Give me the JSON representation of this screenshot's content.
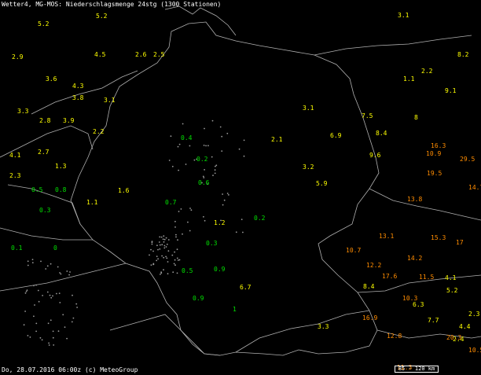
{
  "header": {
    "title": "Wetter4, MG-MOS: Niederschlagsmenge 24stg (1300 Stationen)"
  },
  "footer": {
    "date": "Do, 28.07.2016 06:00z (c) MeteoGroup"
  },
  "scale": {
    "label": "85 - 120 km"
  },
  "colors": {
    "background": "#000000",
    "border": "#b0b0b0",
    "dry_dot": "#9a9a9a",
    "class_low": "#00e000",
    "class_mid": "#ffff00",
    "class_high": "#ff8c00"
  },
  "stations": [
    {
      "v": "5.2",
      "c": "mid"
    },
    {
      "v": "5.2",
      "c": "mid"
    },
    {
      "v": "2.9",
      "c": "mid"
    },
    {
      "v": "4.5",
      "c": "mid"
    },
    {
      "v": "2.6",
      "c": "mid"
    },
    {
      "v": "2.5",
      "c": "mid"
    },
    {
      "v": "3.6",
      "c": "mid"
    },
    {
      "v": "4.3",
      "c": "mid"
    },
    {
      "v": "3.8",
      "c": "mid"
    },
    {
      "v": "3.1",
      "c": "mid"
    },
    {
      "v": "3.3",
      "c": "mid"
    },
    {
      "v": "2.8",
      "c": "mid"
    },
    {
      "v": "3.9",
      "c": "mid"
    },
    {
      "v": "2.2",
      "c": "mid"
    },
    {
      "v": "2.7",
      "c": "mid"
    },
    {
      "v": "1.3",
      "c": "mid"
    },
    {
      "v": "4.1",
      "c": "mid"
    },
    {
      "v": "1.1",
      "c": "mid"
    },
    {
      "v": "2.3",
      "c": "mid"
    },
    {
      "v": "1.6",
      "c": "mid"
    },
    {
      "v": "0.5",
      "c": "low"
    },
    {
      "v": "0.3",
      "c": "low"
    },
    {
      "v": "0.8",
      "c": "low"
    },
    {
      "v": "0.1",
      "c": "low"
    },
    {
      "v": "0",
      "c": "low"
    },
    {
      "v": "0.4",
      "c": "low"
    },
    {
      "v": "0.2",
      "c": "low"
    },
    {
      "v": "0.6",
      "c": "low"
    },
    {
      "v": "0.7",
      "c": "low"
    },
    {
      "v": "0.9",
      "c": "low"
    },
    {
      "v": "3.1",
      "c": "mid"
    },
    {
      "v": "2.1",
      "c": "mid"
    },
    {
      "v": "1.2",
      "c": "mid"
    },
    {
      "v": "3.2",
      "c": "mid"
    },
    {
      "v": "6.7",
      "c": "mid"
    },
    {
      "v": "9.6",
      "c": "mid"
    },
    {
      "v": "8.4",
      "c": "mid"
    },
    {
      "v": "7.5",
      "c": "mid"
    },
    {
      "v": "6.9",
      "c": "mid"
    },
    {
      "v": "5.9",
      "c": "mid"
    },
    {
      "v": "16.3",
      "c": "high"
    },
    {
      "v": "10.9",
      "c": "high"
    },
    {
      "v": "19.5",
      "c": "high"
    },
    {
      "v": "29.5",
      "c": "high"
    },
    {
      "v": "14.7",
      "c": "high"
    },
    {
      "v": "13.8",
      "c": "high"
    },
    {
      "v": "15.3",
      "c": "high"
    },
    {
      "v": "17",
      "c": "high"
    },
    {
      "v": "14.2",
      "c": "high"
    },
    {
      "v": "10.7",
      "c": "high"
    },
    {
      "v": "12.2",
      "c": "high"
    },
    {
      "v": "17.6",
      "c": "high"
    },
    {
      "v": "11.5",
      "c": "high"
    },
    {
      "v": "13.1",
      "c": "high"
    },
    {
      "v": "10.3",
      "c": "high"
    },
    {
      "v": "16.9",
      "c": "high"
    },
    {
      "v": "12.8",
      "c": "high"
    },
    {
      "v": "11.3",
      "c": "high"
    },
    {
      "v": "20.3",
      "c": "high"
    },
    {
      "v": "10.5",
      "c": "high"
    },
    {
      "v": "3.1",
      "c": "mid"
    },
    {
      "v": "8.2",
      "c": "mid"
    },
    {
      "v": "2.2",
      "c": "mid"
    },
    {
      "v": "1.1",
      "c": "mid"
    },
    {
      "v": "9.1",
      "c": "mid"
    },
    {
      "v": "8",
      "c": "mid"
    },
    {
      "v": "4.1",
      "c": "mid"
    },
    {
      "v": "5.2",
      "c": "mid"
    },
    {
      "v": "2.3",
      "c": "mid"
    },
    {
      "v": "4.4",
      "c": "mid"
    },
    {
      "v": "7.7",
      "c": "mid"
    },
    {
      "v": "3.3",
      "c": "mid"
    },
    {
      "v": "8.4",
      "c": "mid"
    },
    {
      "v": "6.3",
      "c": "mid"
    },
    {
      "v": "2.4",
      "c": "mid"
    },
    {
      "v": "0.3",
      "c": "low"
    },
    {
      "v": "0.5",
      "c": "low"
    },
    {
      "v": "0.9",
      "c": "low"
    },
    {
      "v": "1",
      "c": "low"
    },
    {
      "v": "0.2",
      "c": "low"
    }
  ]
}
